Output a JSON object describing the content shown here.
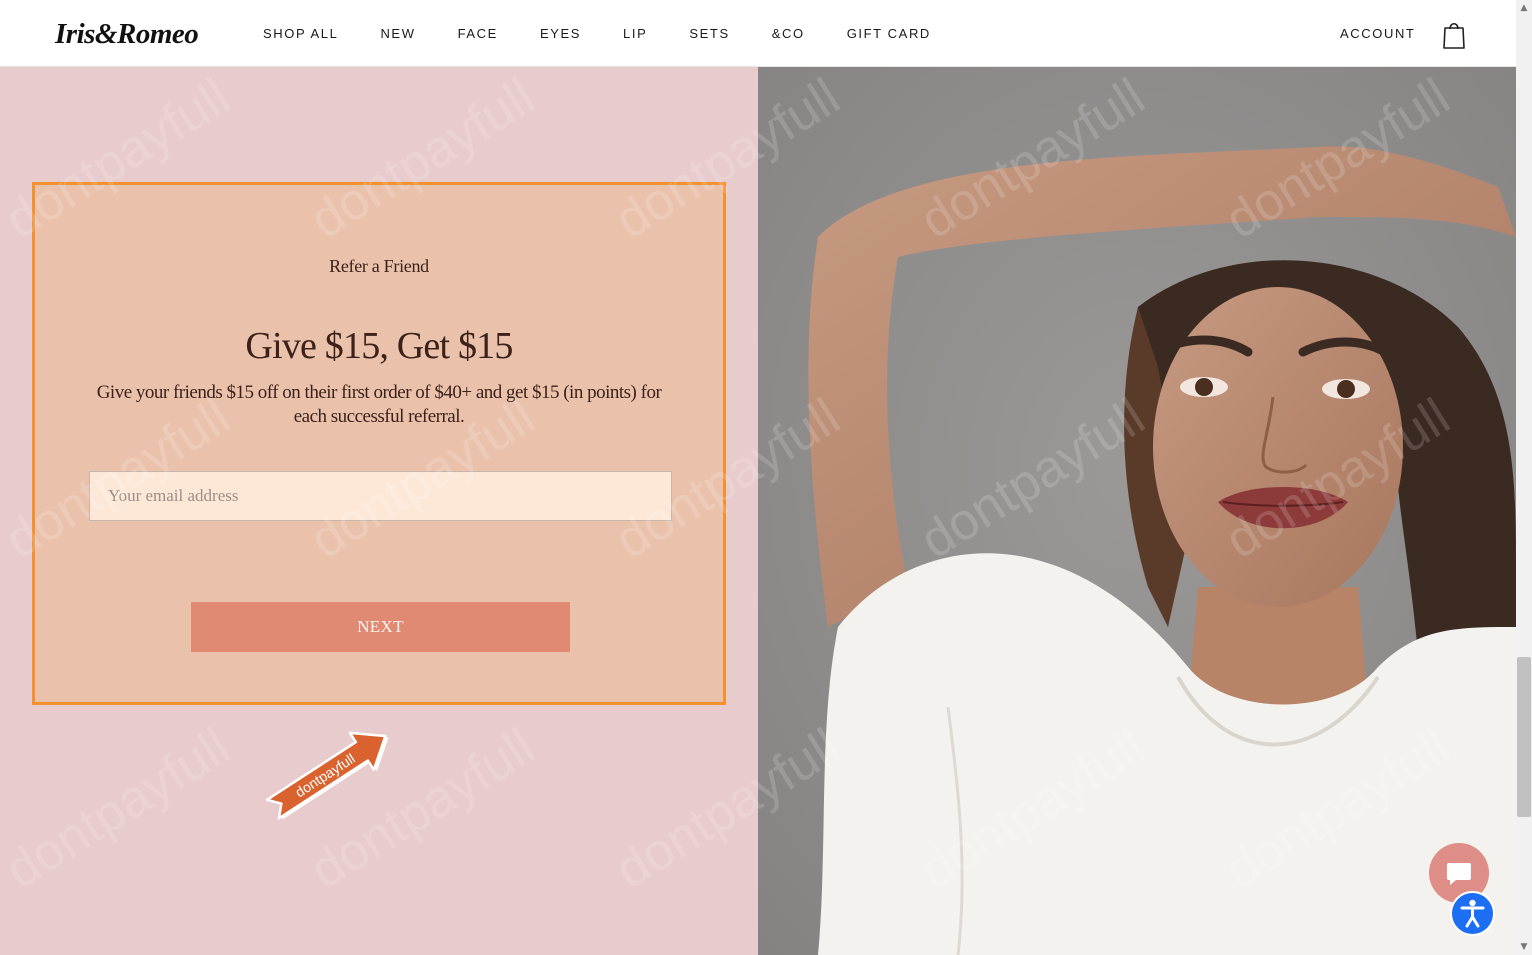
{
  "header": {
    "logo": "Iris&Romeo",
    "nav": [
      "SHOP ALL",
      "NEW",
      "FACE",
      "EYES",
      "LIP",
      "SETS",
      "&CO",
      "GIFT CARD"
    ],
    "account_label": "ACCOUNT",
    "bag_icon": "shopping-bag-icon"
  },
  "refer": {
    "kicker": "Refer a Friend",
    "title": "Give $15, Get $15",
    "description": "Give your friends $15 off on their first order of $40+ and get $15 (in points) for each successful referral.",
    "email_placeholder": "Your email address",
    "email_value": "",
    "next_label": "NEXT"
  },
  "badge": {
    "text": "dontpayfull"
  },
  "watermark": {
    "text": "dontpayfull"
  },
  "widgets": {
    "chat_icon": "chat-bubble-icon",
    "accessibility_icon": "accessibility-person-icon"
  },
  "colors": {
    "panel_pink": "#e8cbcd",
    "box_fill": "#eac2ac",
    "box_border": "#f2912e",
    "button": "#e08a74",
    "text_brown": "#3b2118",
    "chat": "#df8d87",
    "a11y": "#1c6ef2"
  }
}
